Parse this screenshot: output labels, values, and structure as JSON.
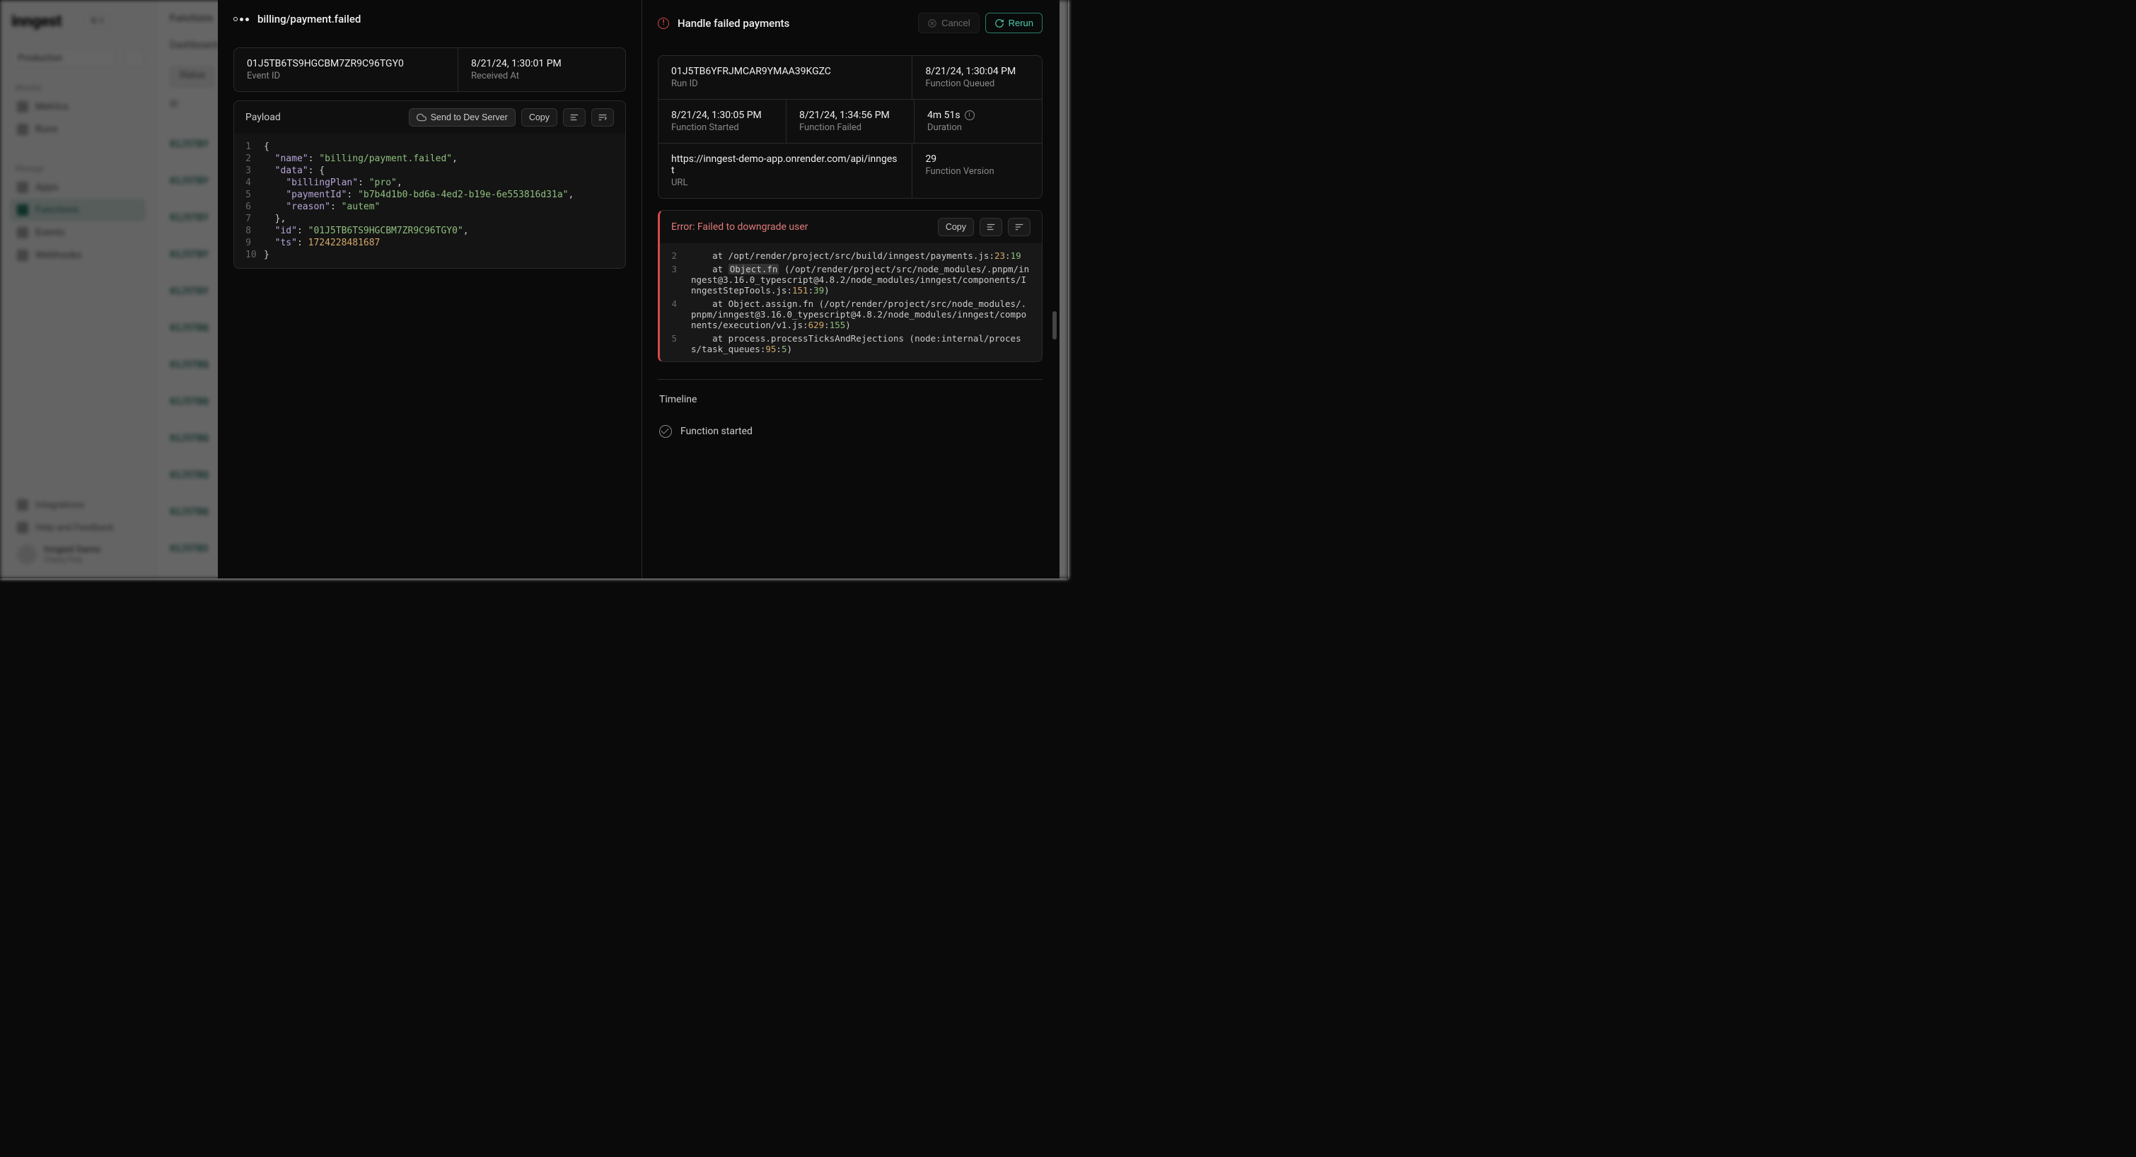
{
  "bg": {
    "logo": "inngest",
    "kbd": "⌘ K",
    "env": "Production",
    "nav_monitor_label": "Monitor",
    "nav_metrics": "Metrics",
    "nav_runs": "Runs",
    "nav_manage_label": "Manage",
    "nav_apps": "Apps",
    "nav_functions": "Functions",
    "nav_events": "Events",
    "nav_webhooks": "Webhooks",
    "integrations": "Integrations",
    "help": "Help and Feedback",
    "user_name": "Inngest Demo",
    "user_sub": "Charly Poly",
    "main_title": "Functions",
    "main_sub": "Dashboard",
    "toolbar_status": "Status",
    "th_id": "ID",
    "rows": [
      "01J5TBY",
      "01J5TBY",
      "01J5TBY",
      "01J5TBY",
      "01J5TBY",
      "01J5TBQ",
      "01J5TBQ",
      "01J5TBQ",
      "01J5TBQ",
      "01J5TBQ",
      "01J5TBQ",
      "01J5TBS"
    ]
  },
  "left": {
    "header_title": "billing/payment.failed",
    "event_id": "01J5TB6TS9HGCBM7ZR9C96TGY0",
    "event_id_label": "Event ID",
    "received_at": "8/21/24, 1:30:01 PM",
    "received_at_label": "Received At",
    "payload_title": "Payload",
    "btn_send": "Send to Dev Server",
    "btn_copy": "Copy"
  },
  "payload_lines": [
    {
      "n": "1",
      "tokens": [
        {
          "t": "punct",
          "v": "{"
        }
      ]
    },
    {
      "n": "2",
      "tokens": [
        {
          "t": "indent",
          "v": "  "
        },
        {
          "t": "key",
          "v": "\"name\""
        },
        {
          "t": "punct",
          "v": ": "
        },
        {
          "t": "str",
          "v": "\"billing/payment.failed\""
        },
        {
          "t": "punct",
          "v": ","
        }
      ]
    },
    {
      "n": "3",
      "tokens": [
        {
          "t": "indent",
          "v": "  "
        },
        {
          "t": "key",
          "v": "\"data\""
        },
        {
          "t": "punct",
          "v": ": {"
        }
      ]
    },
    {
      "n": "4",
      "tokens": [
        {
          "t": "indent",
          "v": "    "
        },
        {
          "t": "key",
          "v": "\"billingPlan\""
        },
        {
          "t": "punct",
          "v": ": "
        },
        {
          "t": "str",
          "v": "\"pro\""
        },
        {
          "t": "punct",
          "v": ","
        }
      ]
    },
    {
      "n": "5",
      "tokens": [
        {
          "t": "indent",
          "v": "    "
        },
        {
          "t": "key",
          "v": "\"paymentId\""
        },
        {
          "t": "punct",
          "v": ": "
        },
        {
          "t": "str",
          "v": "\"b7b4d1b0-bd6a-4ed2-b19e-6e553816d31a\""
        },
        {
          "t": "punct",
          "v": ","
        }
      ]
    },
    {
      "n": "6",
      "tokens": [
        {
          "t": "indent",
          "v": "    "
        },
        {
          "t": "key",
          "v": "\"reason\""
        },
        {
          "t": "punct",
          "v": ": "
        },
        {
          "t": "str",
          "v": "\"autem\""
        }
      ]
    },
    {
      "n": "7",
      "tokens": [
        {
          "t": "indent",
          "v": "  "
        },
        {
          "t": "punct",
          "v": "},"
        }
      ]
    },
    {
      "n": "8",
      "tokens": [
        {
          "t": "indent",
          "v": "  "
        },
        {
          "t": "key",
          "v": "\"id\""
        },
        {
          "t": "punct",
          "v": ": "
        },
        {
          "t": "str",
          "v": "\"01J5TB6TS9HGCBM7ZR9C96TGY0\""
        },
        {
          "t": "punct",
          "v": ","
        }
      ]
    },
    {
      "n": "9",
      "tokens": [
        {
          "t": "indent",
          "v": "  "
        },
        {
          "t": "key",
          "v": "\"ts\""
        },
        {
          "t": "punct",
          "v": ": "
        },
        {
          "t": "num",
          "v": "1724228481687"
        }
      ]
    },
    {
      "n": "10",
      "tokens": [
        {
          "t": "punct",
          "v": "}"
        }
      ]
    }
  ],
  "right": {
    "header_title": "Handle failed payments",
    "btn_cancel": "Cancel",
    "btn_rerun": "Rerun",
    "run_id": "01J5TB6YFRJMCAR9YMAA39KGZC",
    "run_id_label": "Run ID",
    "queued": "8/21/24, 1:30:04 PM",
    "queued_label": "Function Queued",
    "started": "8/21/24, 1:30:05 PM",
    "started_label": "Function Started",
    "failed": "8/21/24, 1:34:56 PM",
    "failed_label": "Function Failed",
    "duration": "4m 51s",
    "duration_label": "Duration",
    "url": "https://inngest-demo-app.onrender.com/api/inngest",
    "url_label": "URL",
    "version": "29",
    "version_label": "Function Version",
    "error_title": "Error: Failed to downgrade user",
    "btn_copy": "Copy",
    "timeline_title": "Timeline",
    "timeline_item": "Function started"
  },
  "error_lines": [
    {
      "n": "2",
      "segs": [
        {
          "v": "    at /opt/render/project/src/build/inngest/payments.js:"
        },
        {
          "c": "err-num1",
          "v": "23"
        },
        {
          "v": ":"
        },
        {
          "c": "err-num2",
          "v": "19"
        }
      ]
    },
    {
      "n": "3",
      "segs": [
        {
          "v": "    at "
        },
        {
          "c": "err-hl",
          "v": "Object.fn"
        },
        {
          "v": " (/opt/render/project/src/node_modules/.pnpm/inngest@3.16.0_typescript@4.8.2/node_modules/inngest/components/InngestStepTools.js:"
        },
        {
          "c": "err-num1",
          "v": "151"
        },
        {
          "v": ":"
        },
        {
          "c": "err-num2",
          "v": "39"
        },
        {
          "v": ")"
        }
      ]
    },
    {
      "n": "4",
      "segs": [
        {
          "v": "    at Object.assign.fn (/opt/render/project/src/node_modules/.pnpm/inngest@3.16.0_typescript@4.8.2/node_modules/inngest/components/execution/v1.js:"
        },
        {
          "c": "err-num1",
          "v": "629"
        },
        {
          "v": ":"
        },
        {
          "c": "err-num2",
          "v": "155"
        },
        {
          "v": ")"
        }
      ]
    },
    {
      "n": "5",
      "segs": [
        {
          "v": "    at process.processTicksAndRejections (node:internal/process/task_queues:"
        },
        {
          "c": "err-num1",
          "v": "95"
        },
        {
          "v": ":"
        },
        {
          "c": "err-num2",
          "v": "5"
        },
        {
          "v": ")"
        }
      ]
    }
  ]
}
